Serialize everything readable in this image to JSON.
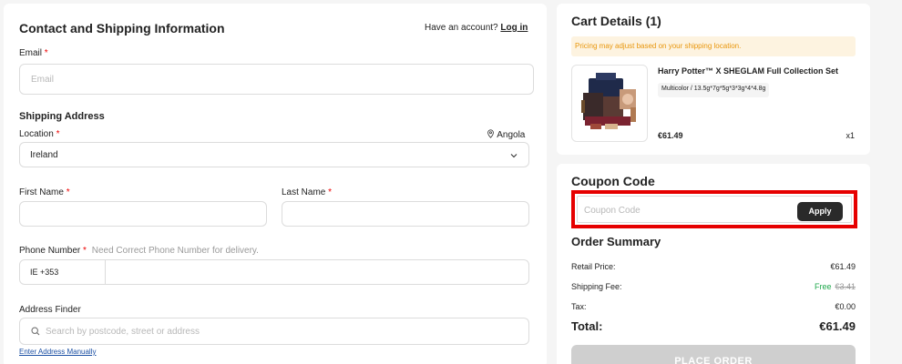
{
  "contact": {
    "title": "Contact and Shipping Information",
    "have_account": "Have an account?",
    "login": "Log in",
    "email_label": "Email",
    "email_placeholder": "Email",
    "required_mark": "*"
  },
  "shipping": {
    "title": "Shipping Address",
    "location_label": "Location",
    "location_hint": "Angola",
    "location_value": "Ireland",
    "first_name_label": "First Name",
    "last_name_label": "Last Name",
    "phone_label": "Phone Number",
    "phone_hint": "Need Correct Phone Number for delivery.",
    "phone_code": "IE +353",
    "finder_label": "Address Finder",
    "finder_placeholder": "Search by postcode, street or address",
    "manual_link": "Enter Address Manually"
  },
  "cart": {
    "title": "Cart Details (1)",
    "notice": "Pricing may adjust based on your shipping location.",
    "product_name": "Harry Potter™ X SHEGLAM Full Collection Set",
    "variant": "Multicolor / 13.5g*7g*5g*3*3g*4*4.8g",
    "price": "€61.49",
    "qty": "x1"
  },
  "coupon": {
    "title": "Coupon Code",
    "placeholder": "Coupon Code",
    "apply": "Apply"
  },
  "summary": {
    "title": "Order Summary",
    "retail_label": "Retail Price:",
    "retail_value": "€61.49",
    "shipping_label": "Shipping Fee:",
    "shipping_free": "Free",
    "shipping_old": "€3.41",
    "tax_label": "Tax:",
    "tax_value": "€0.00",
    "total_label": "Total:",
    "total_value": "€61.49",
    "place_order": "PLACE ORDER"
  },
  "icons": {
    "location": "location-pin-icon",
    "chevron": "chevron-down-icon",
    "search": "search-icon"
  },
  "colors": {
    "accent_red": "#e60000",
    "free_green": "#1fa84c",
    "notice_orange": "#e8960c"
  }
}
